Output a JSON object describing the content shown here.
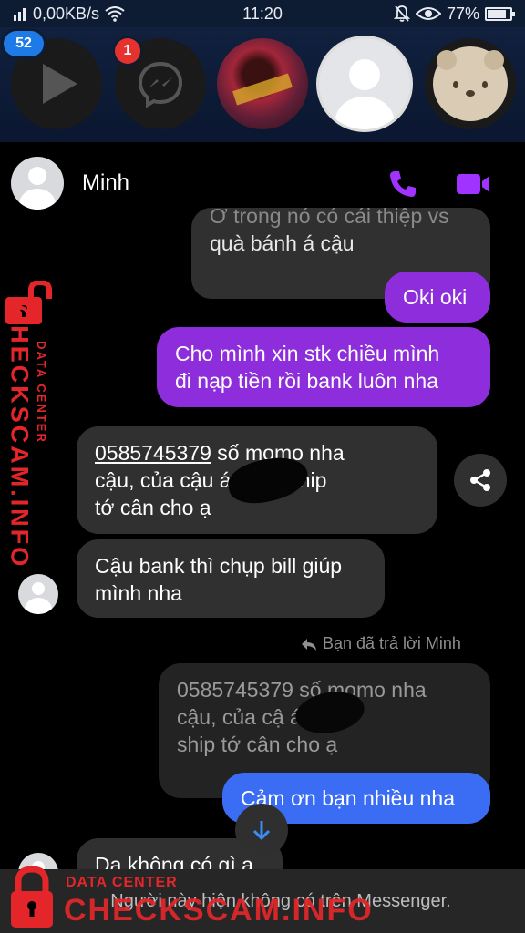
{
  "status_bar": {
    "network_speed": "0,00KB/s",
    "time": "11:20",
    "battery_percent": "77%",
    "battery_level": 0.77
  },
  "chat_heads": {
    "unread_count_badge": "52",
    "messenger_badge": "1"
  },
  "chat": {
    "contact_name": "Minh",
    "messages": [
      {
        "id": "m0",
        "direction": "incoming",
        "line1": "Ở trong nó có cái thiệp vs",
        "line2": "quà bánh á cậu"
      },
      {
        "id": "m1",
        "direction": "outgoing",
        "text": "Oki oki"
      },
      {
        "id": "m2",
        "direction": "outgoing",
        "line1": "Cho mình xin stk chiều mình",
        "line2": "đi nạp tiền rồi bank luôn nha"
      },
      {
        "id": "m3",
        "direction": "incoming",
        "phone": "0585745379",
        "line1_rest": " số momo nha",
        "line2": "cậu, của cậu       á. Tiền ship",
        "line3": "tớ cân cho ạ"
      },
      {
        "id": "m4",
        "direction": "incoming",
        "line1": "Cậu bank thì chụp bill giúp",
        "line2": "mình nha"
      }
    ],
    "reply_note": "Bạn đã trả lời Minh",
    "quoted_reply": {
      "line1": "0585745379 số momo nha",
      "line2": "cậu, của cậ        á. Tiền",
      "line3": "ship tớ cân cho ạ"
    },
    "reply_message": "Cảm ơn bạn nhiều nha",
    "last_incoming": "Dạ không có gì ạ",
    "unavailable_notice": "Người này hiện không có trên Messenger."
  },
  "watermark": {
    "side_title": "CHECKSCAM.INFO",
    "side_subtitle": "DATA CENTER",
    "bottom_subtitle": "DATA CENTER",
    "bottom_title": "CHECKSCAM.INFO"
  },
  "colors": {
    "outgoing_bubble": "#8d2ddb",
    "reply_bubble": "#3a6cf4",
    "incoming_bubble": "#303030",
    "watermark_red": "#e4262b"
  }
}
